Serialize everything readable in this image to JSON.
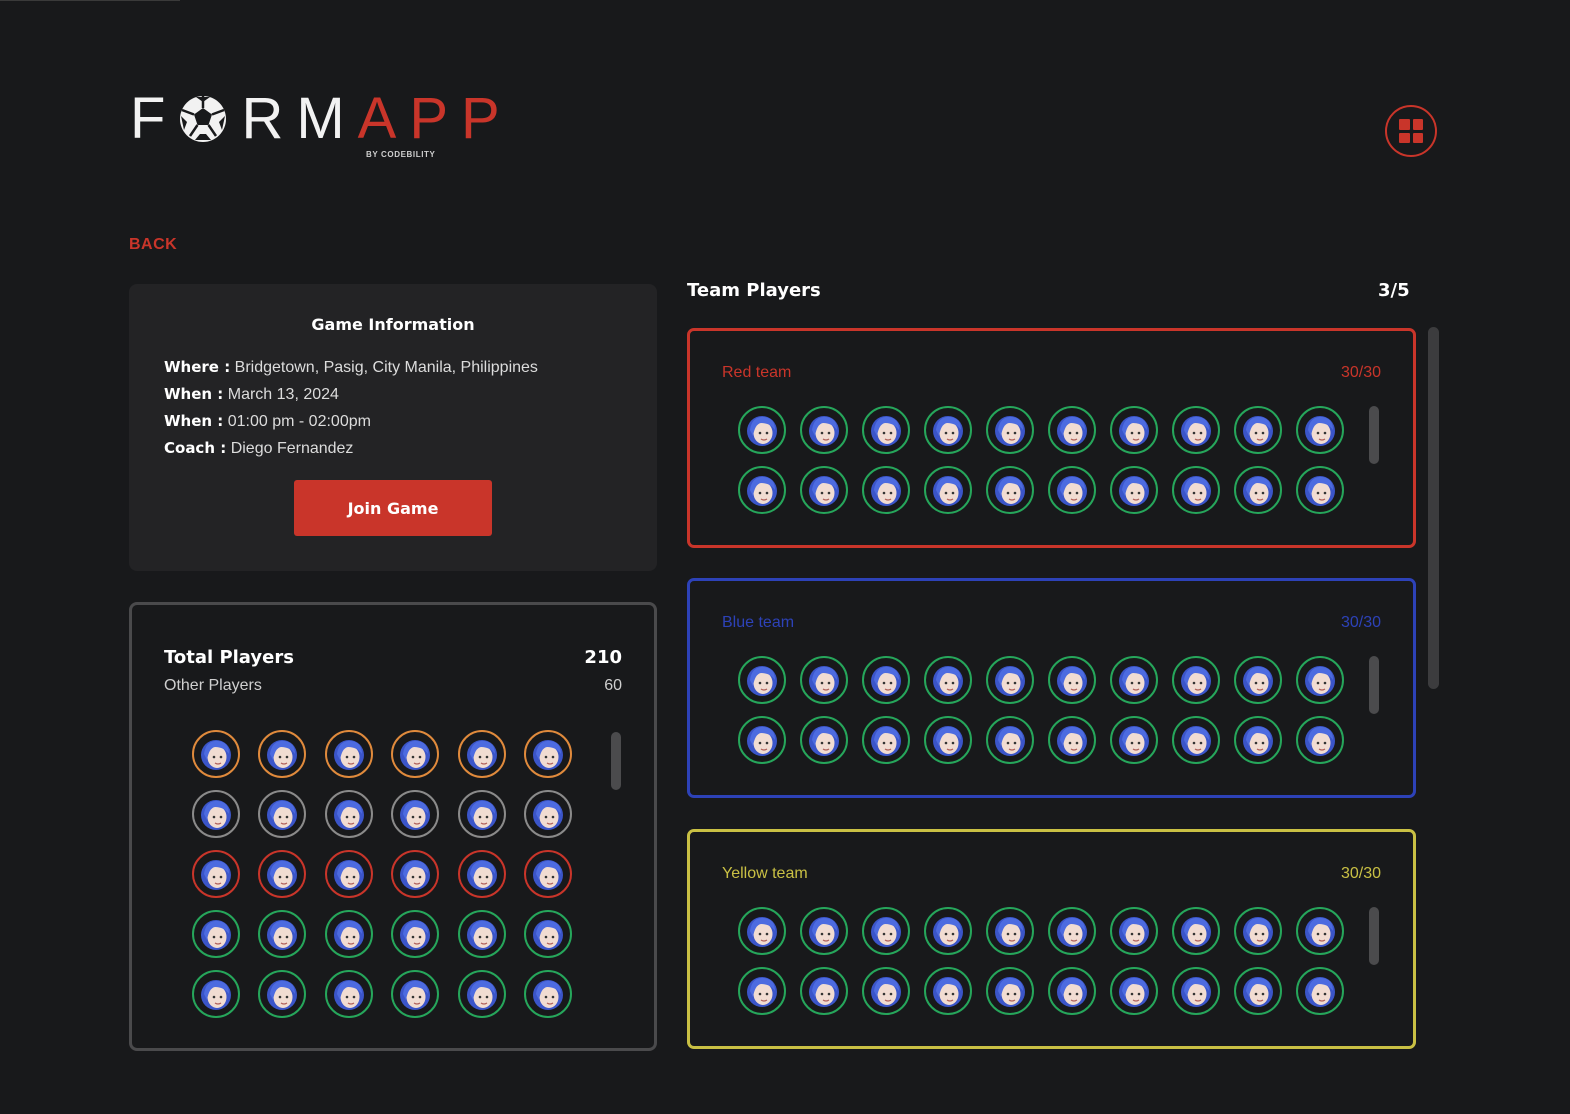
{
  "app": {
    "logo_left": "F",
    "logo_mid": "RM",
    "logo_right": "APP",
    "logo_sub": "BY CODEBILITY",
    "menu_icon": "grid-icon",
    "accent": "#c9352a"
  },
  "nav": {
    "back_label": "BACK"
  },
  "game_info": {
    "title": "Game Information",
    "rows": [
      {
        "label": "Where :",
        "value": "Bridgetown, Pasig, City Manila, Philippines"
      },
      {
        "label": "When :",
        "value": "March 13, 2024"
      },
      {
        "label": "When :",
        "value": "01:00 pm - 02:00pm"
      },
      {
        "label": "Coach :",
        "value": "Diego Fernandez"
      }
    ],
    "join_label": "Join Game"
  },
  "total_players": {
    "title": "Total Players",
    "total": "210",
    "other_label": "Other Players",
    "other_count": "60",
    "avatar_rows": [
      {
        "ring": "#e08a3c",
        "count": 6
      },
      {
        "ring": "#8a8a8a",
        "count": 6
      },
      {
        "ring": "#c9352a",
        "count": 6
      },
      {
        "ring": "#26a65b",
        "count": 6
      },
      {
        "ring": "#26a65b",
        "count": 6
      }
    ]
  },
  "team_players": {
    "title": "Team Players",
    "page": "3/5",
    "teams": [
      {
        "name": "Red team",
        "score": "30/30",
        "color": "#c9352a",
        "avatars_shown": 20
      },
      {
        "name": "Blue team",
        "score": "30/30",
        "color": "#2d42b8",
        "avatars_shown": 20
      },
      {
        "name": "Yellow team",
        "score": "30/30",
        "color": "#c9c044",
        "avatars_shown": 20
      }
    ],
    "avatar_ring": "#26a65b"
  }
}
